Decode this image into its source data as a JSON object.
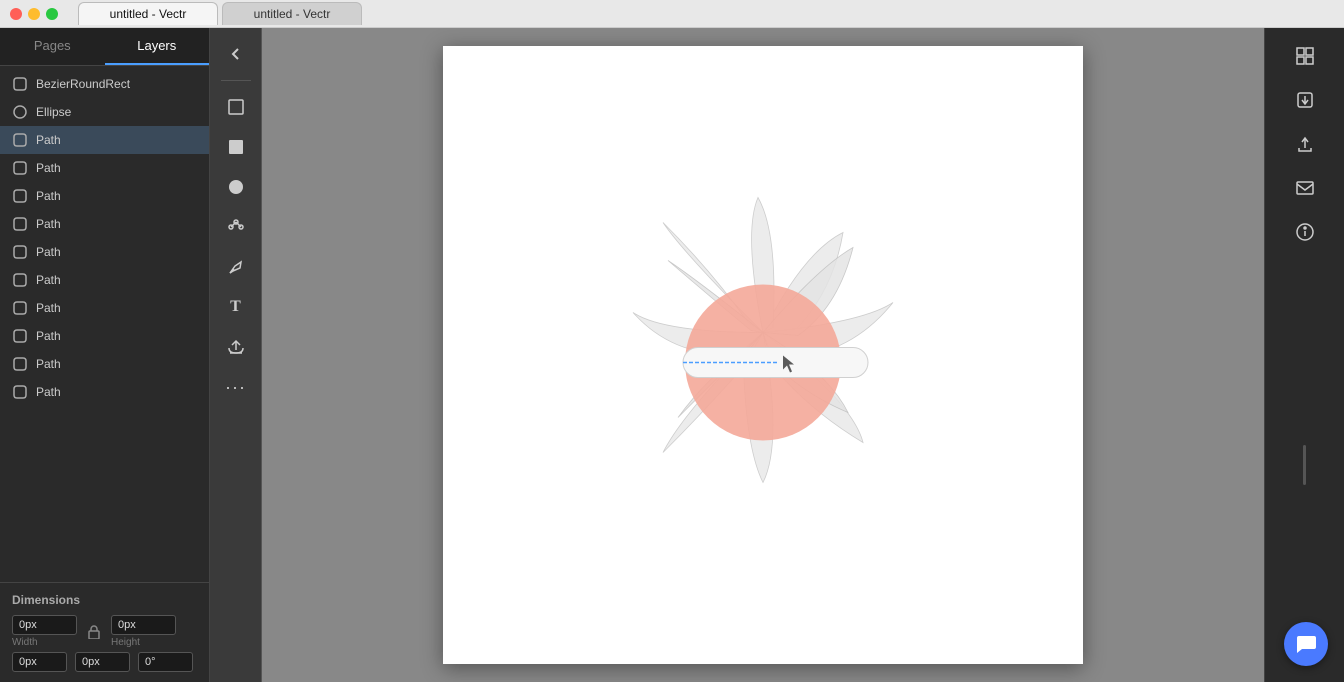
{
  "titlebar": {
    "tabs": [
      {
        "label": "untitled - Vectr",
        "active": true
      },
      {
        "label": "untitled - Vectr",
        "active": false
      }
    ],
    "buttons": {
      "close_label": "●",
      "min_label": "●",
      "max_label": "●"
    }
  },
  "sidebar": {
    "pages_tab": "Pages",
    "layers_tab": "Layers",
    "layers": [
      {
        "id": 1,
        "label": "BezierRoundRect",
        "icon": "path-icon"
      },
      {
        "id": 2,
        "label": "Ellipse",
        "icon": "path-icon"
      },
      {
        "id": 3,
        "label": "Path",
        "icon": "path-icon"
      },
      {
        "id": 4,
        "label": "Path",
        "icon": "path-icon"
      },
      {
        "id": 5,
        "label": "Path",
        "icon": "path-icon"
      },
      {
        "id": 6,
        "label": "Path",
        "icon": "path-icon"
      },
      {
        "id": 7,
        "label": "Path",
        "icon": "path-icon"
      },
      {
        "id": 8,
        "label": "Path",
        "icon": "path-icon"
      },
      {
        "id": 9,
        "label": "Path",
        "icon": "path-icon"
      },
      {
        "id": 10,
        "label": "Path",
        "icon": "path-icon"
      },
      {
        "id": 11,
        "label": "Path",
        "icon": "path-icon"
      },
      {
        "id": 12,
        "label": "Path",
        "icon": "path-icon"
      }
    ]
  },
  "dimensions": {
    "title": "Dimensions",
    "width_label": "Width",
    "height_label": "Height",
    "width_value": "0px",
    "height_value": "0px",
    "x_value": "0px",
    "y_value": "0px",
    "rotation_value": "0°"
  },
  "toolbar": {
    "back_label": "‹",
    "tools": [
      {
        "name": "select",
        "icon": "⬜",
        "label": "Select Tool"
      },
      {
        "name": "fill",
        "icon": "⬛",
        "label": "Fill Tool"
      },
      {
        "name": "circle",
        "icon": "⬤",
        "label": "Circle Tool"
      },
      {
        "name": "node",
        "icon": "✦",
        "label": "Node Tool"
      },
      {
        "name": "pen",
        "icon": "✏",
        "label": "Pen Tool"
      },
      {
        "name": "text",
        "icon": "T",
        "label": "Text Tool"
      },
      {
        "name": "upload",
        "icon": "⬆",
        "label": "Upload"
      },
      {
        "name": "more",
        "icon": "···",
        "label": "More"
      }
    ]
  },
  "right_panel": {
    "tools": [
      {
        "name": "grid",
        "icon": "⊞",
        "label": "Grid"
      },
      {
        "name": "import",
        "icon": "⬇",
        "label": "Import"
      },
      {
        "name": "export",
        "icon": "⬆",
        "label": "Export"
      },
      {
        "name": "share",
        "icon": "◫",
        "label": "Share"
      },
      {
        "name": "info",
        "icon": "ℹ",
        "label": "Info"
      }
    ]
  },
  "canvas": {
    "title": "untitled",
    "flower": {
      "petal_color": "#e8e8e8",
      "petal_stroke": "#bbb",
      "circle_color": "#f4a899",
      "bar_color": "#f5f5f5",
      "bar_stroke": "#ccc",
      "selection_color": "#4a9eff"
    }
  },
  "chat_button": {
    "icon": "💬"
  }
}
